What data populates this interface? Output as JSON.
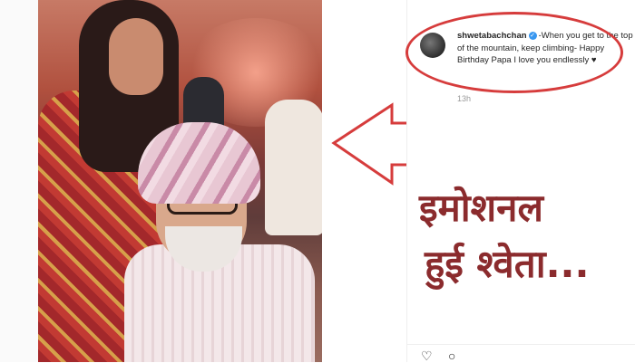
{
  "post": {
    "username": "shwetabachchan",
    "caption": "-When you get to the top of the mountain, keep climbing- Happy Birthday Papa I love you endlessly ♥",
    "time": "13h"
  },
  "headline": {
    "line1": "इमोशनल",
    "line2": "हुई श्वेता..."
  },
  "icons": {
    "verified": "verified-badge-icon",
    "like": "heart-icon",
    "comment": "comment-icon"
  },
  "colors": {
    "annotation_red": "#d63c3c",
    "headline_maroon": "#8b2b2d",
    "verified_blue": "#3897f0"
  }
}
